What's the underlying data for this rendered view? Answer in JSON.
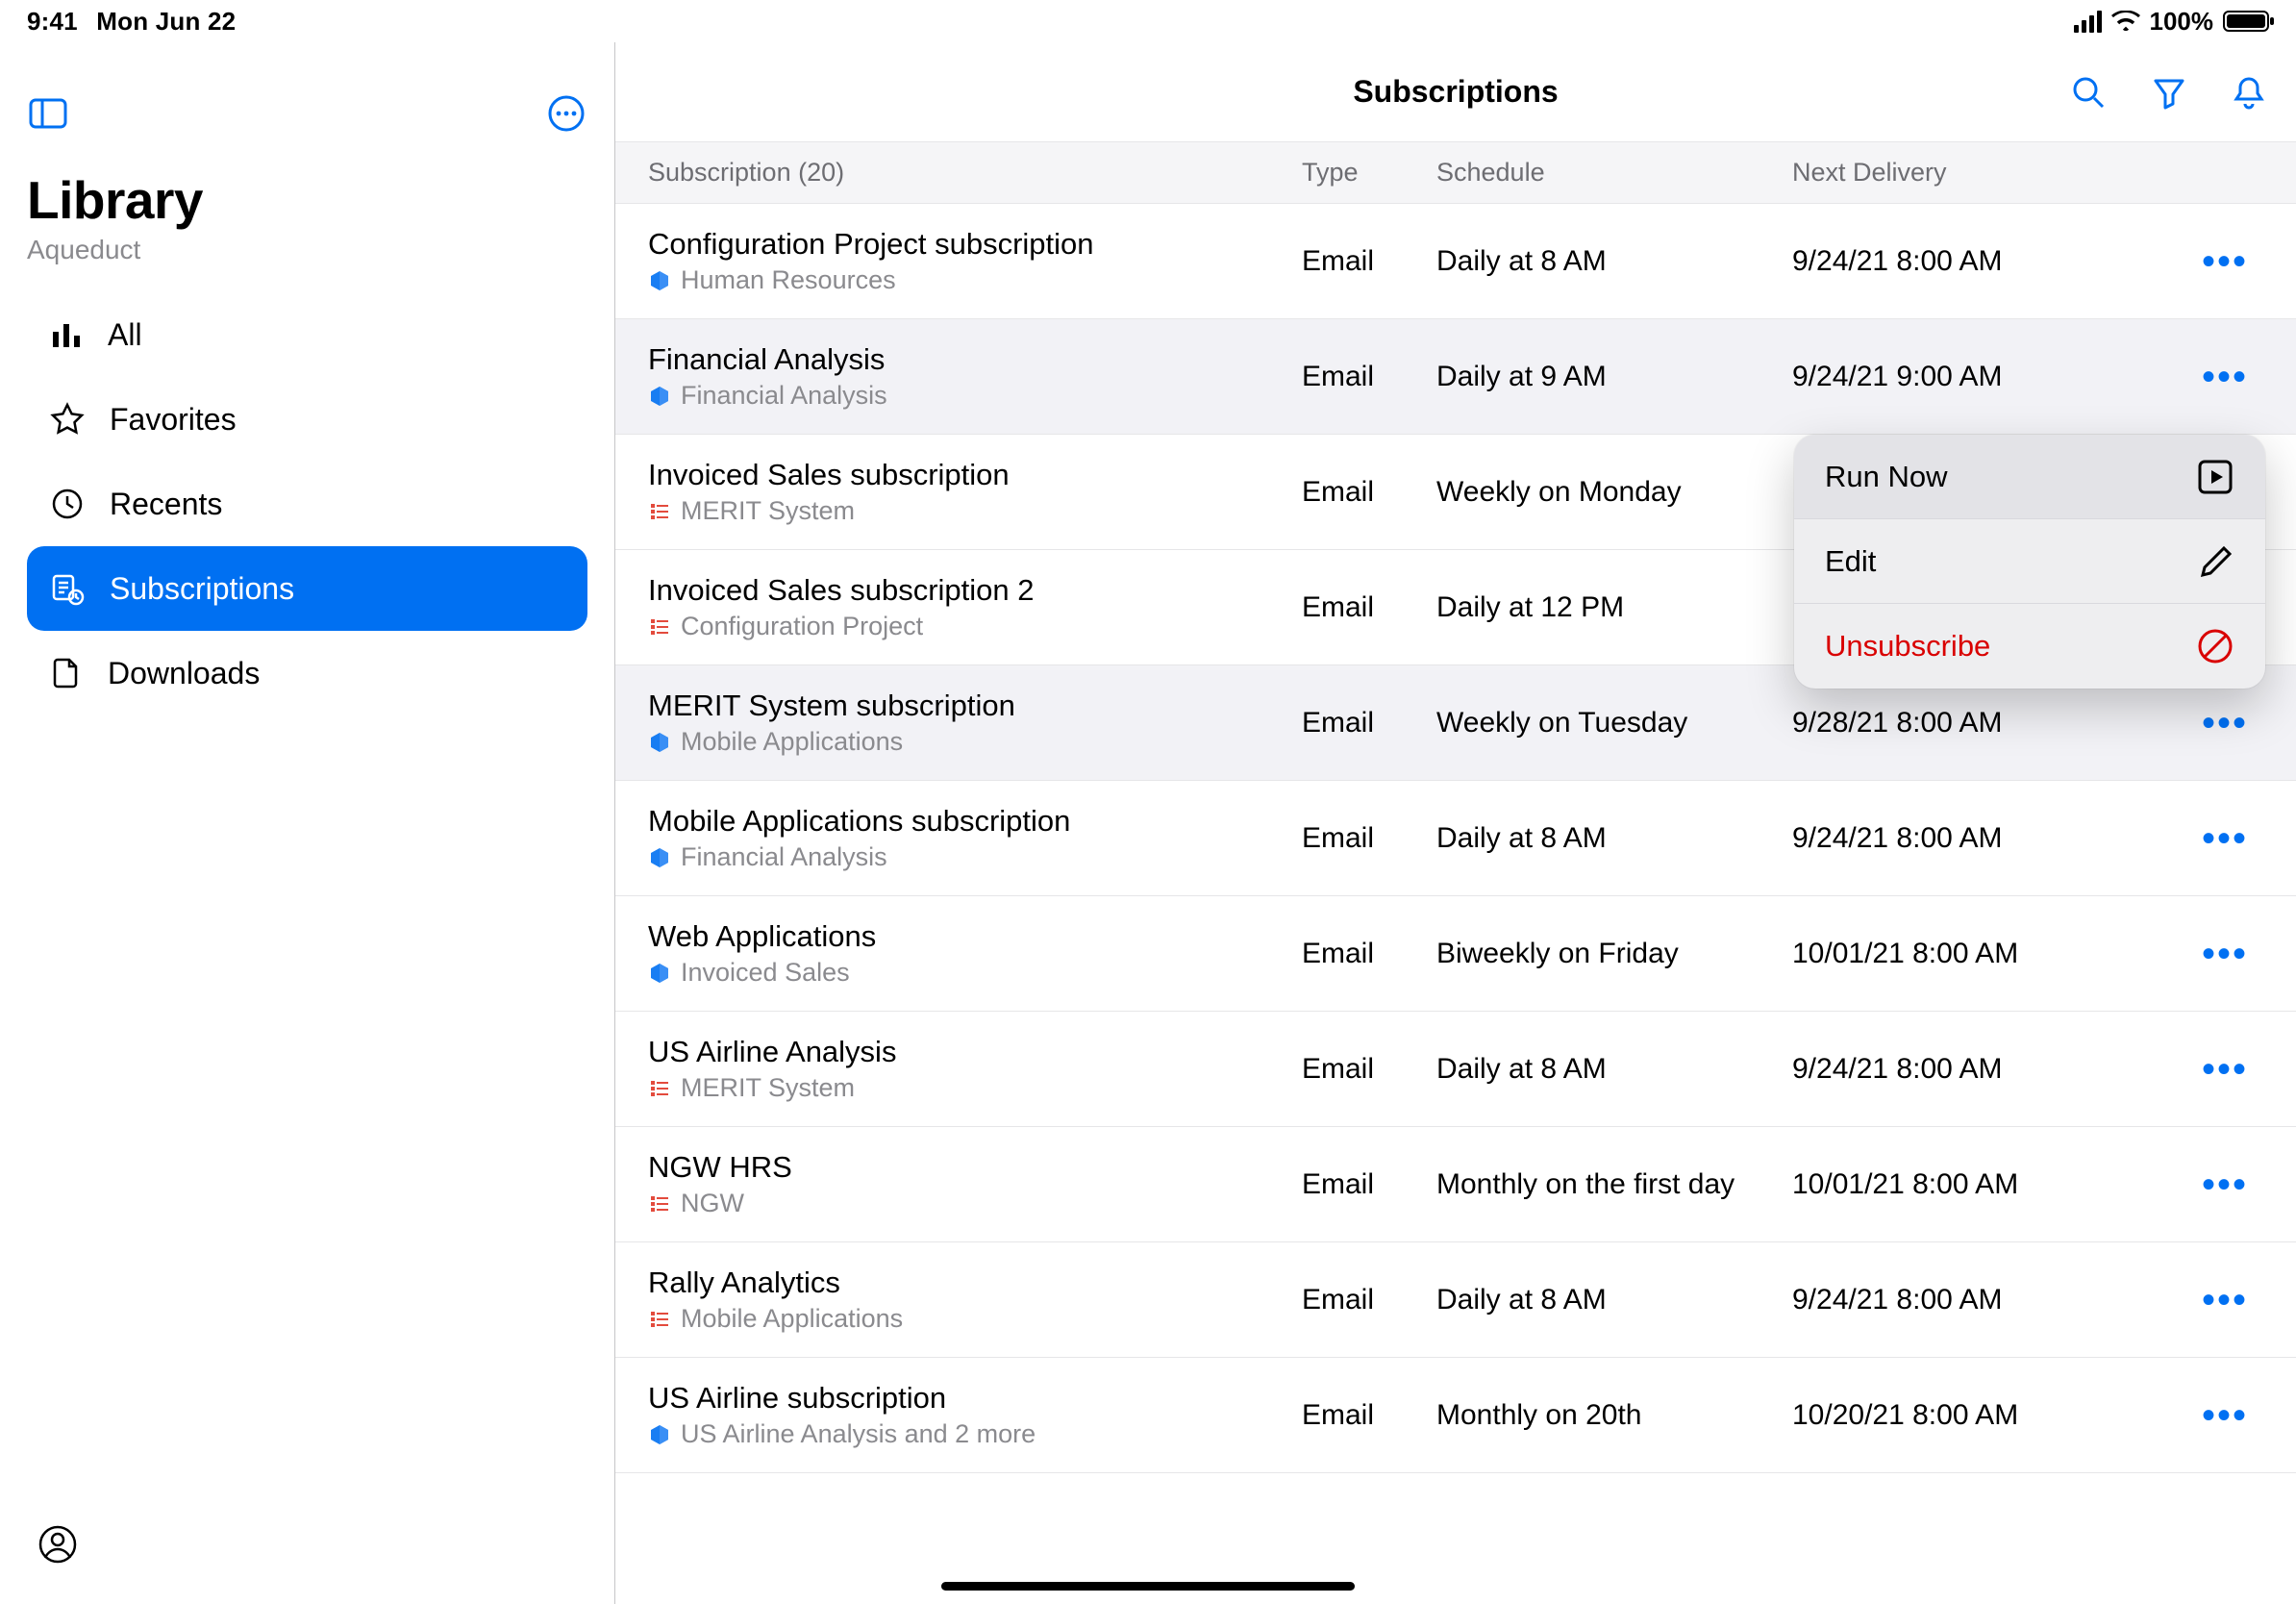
{
  "status": {
    "time": "9:41",
    "date": "Mon Jun 22",
    "pct": "100%"
  },
  "sidebar": {
    "title": "Library",
    "subtitle": "Aqueduct",
    "items": [
      {
        "label": "All"
      },
      {
        "label": "Favorites"
      },
      {
        "label": "Recents"
      },
      {
        "label": "Subscriptions"
      },
      {
        "label": "Downloads"
      }
    ]
  },
  "header": {
    "title": "Subscriptions"
  },
  "columns": {
    "sub": "Subscription (20)",
    "type": "Type",
    "sched": "Schedule",
    "next": "Next Delivery"
  },
  "rows": [
    {
      "title": "Configuration Project subscription",
      "src": "Human Resources",
      "icon": "cube",
      "type": "Email",
      "sched": "Daily at 8 AM",
      "next": "9/24/21 8:00 AM"
    },
    {
      "title": "Financial Analysis",
      "src": "Financial Analysis",
      "icon": "cube",
      "type": "Email",
      "sched": "Daily at 9 AM",
      "next": "9/24/21 9:00 AM"
    },
    {
      "title": "Invoiced Sales subscription",
      "src": "MERIT System",
      "icon": "list",
      "type": "Email",
      "sched": "Weekly on Monday",
      "next": ""
    },
    {
      "title": "Invoiced Sales subscription 2",
      "src": "Configuration Project",
      "icon": "list",
      "type": "Email",
      "sched": "Daily at 12 PM",
      "next": ""
    },
    {
      "title": "MERIT System subscription",
      "src": "Mobile Applications",
      "icon": "cube",
      "type": "Email",
      "sched": "Weekly on Tuesday",
      "next": "9/28/21 8:00 AM"
    },
    {
      "title": "Mobile Applications subscription",
      "src": "Financial Analysis",
      "icon": "cube",
      "type": "Email",
      "sched": "Daily at 8 AM",
      "next": "9/24/21 8:00 AM"
    },
    {
      "title": "Web Applications",
      "src": "Invoiced Sales",
      "icon": "cube",
      "type": "Email",
      "sched": "Biweekly on Friday",
      "next": "10/01/21 8:00 AM"
    },
    {
      "title": "US Airline Analysis",
      "src": "MERIT System",
      "icon": "list",
      "type": "Email",
      "sched": "Daily at 8 AM",
      "next": "9/24/21 8:00 AM"
    },
    {
      "title": "NGW HRS",
      "src": "NGW",
      "icon": "list",
      "type": "Email",
      "sched": "Monthly on the first day",
      "next": "10/01/21 8:00 AM"
    },
    {
      "title": "Rally Analytics",
      "src": "Mobile Applications",
      "icon": "list",
      "type": "Email",
      "sched": "Daily at 8 AM",
      "next": "9/24/21 8:00 AM"
    },
    {
      "title": "US Airline subscription",
      "src": "US Airline Analysis and 2 more",
      "icon": "cube",
      "type": "Email",
      "sched": "Monthly on 20th",
      "next": "10/20/21 8:00 AM"
    }
  ],
  "popover": {
    "run": "Run Now",
    "edit": "Edit",
    "unsub": "Unsubscribe"
  }
}
